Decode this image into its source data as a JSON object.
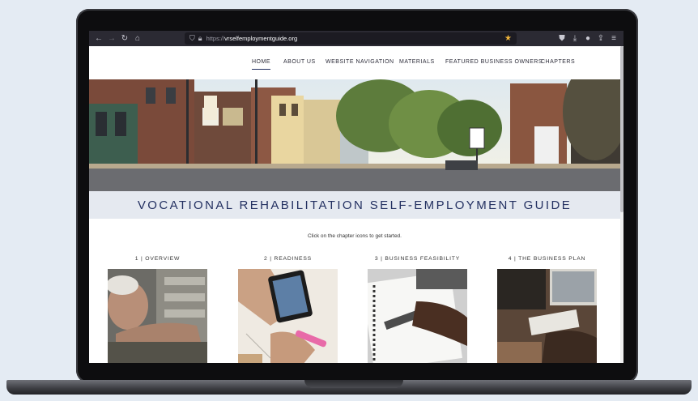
{
  "browser": {
    "url_protocol": "https://",
    "url_host": "vrselfemploymentguide.org",
    "icons": [
      "back-icon",
      "forward-icon",
      "reload-icon",
      "home-icon",
      "shield-icon",
      "lock-icon",
      "star-icon",
      "pocket-icon",
      "download-icon",
      "account-icon",
      "extensions-icon",
      "menu-icon"
    ]
  },
  "nav": {
    "items": [
      {
        "label": "HOME",
        "active": true
      },
      {
        "label": "ABOUT US"
      },
      {
        "label": "WEBSITE NAVIGATION"
      },
      {
        "label": "MATERIALS"
      },
      {
        "label": "FEATURED BUSINESS OWNERS"
      },
      {
        "label": "CHAPTERS"
      }
    ]
  },
  "title": "VOCATIONAL REHABILITATION SELF-EMPLOYMENT GUIDE",
  "instruction": "Click on the chapter icons to get started.",
  "chapters": [
    {
      "label": "1 | OVERVIEW"
    },
    {
      "label": "2 | READINESS"
    },
    {
      "label": "3 | BUSINESS FEASIBILITY"
    },
    {
      "label": "4 | THE BUSINESS PLAN"
    }
  ],
  "colors": {
    "accent": "#233061",
    "title_band": "#e5e9f0",
    "toolbar": "#2b2a33",
    "star": "#f2b63a"
  }
}
